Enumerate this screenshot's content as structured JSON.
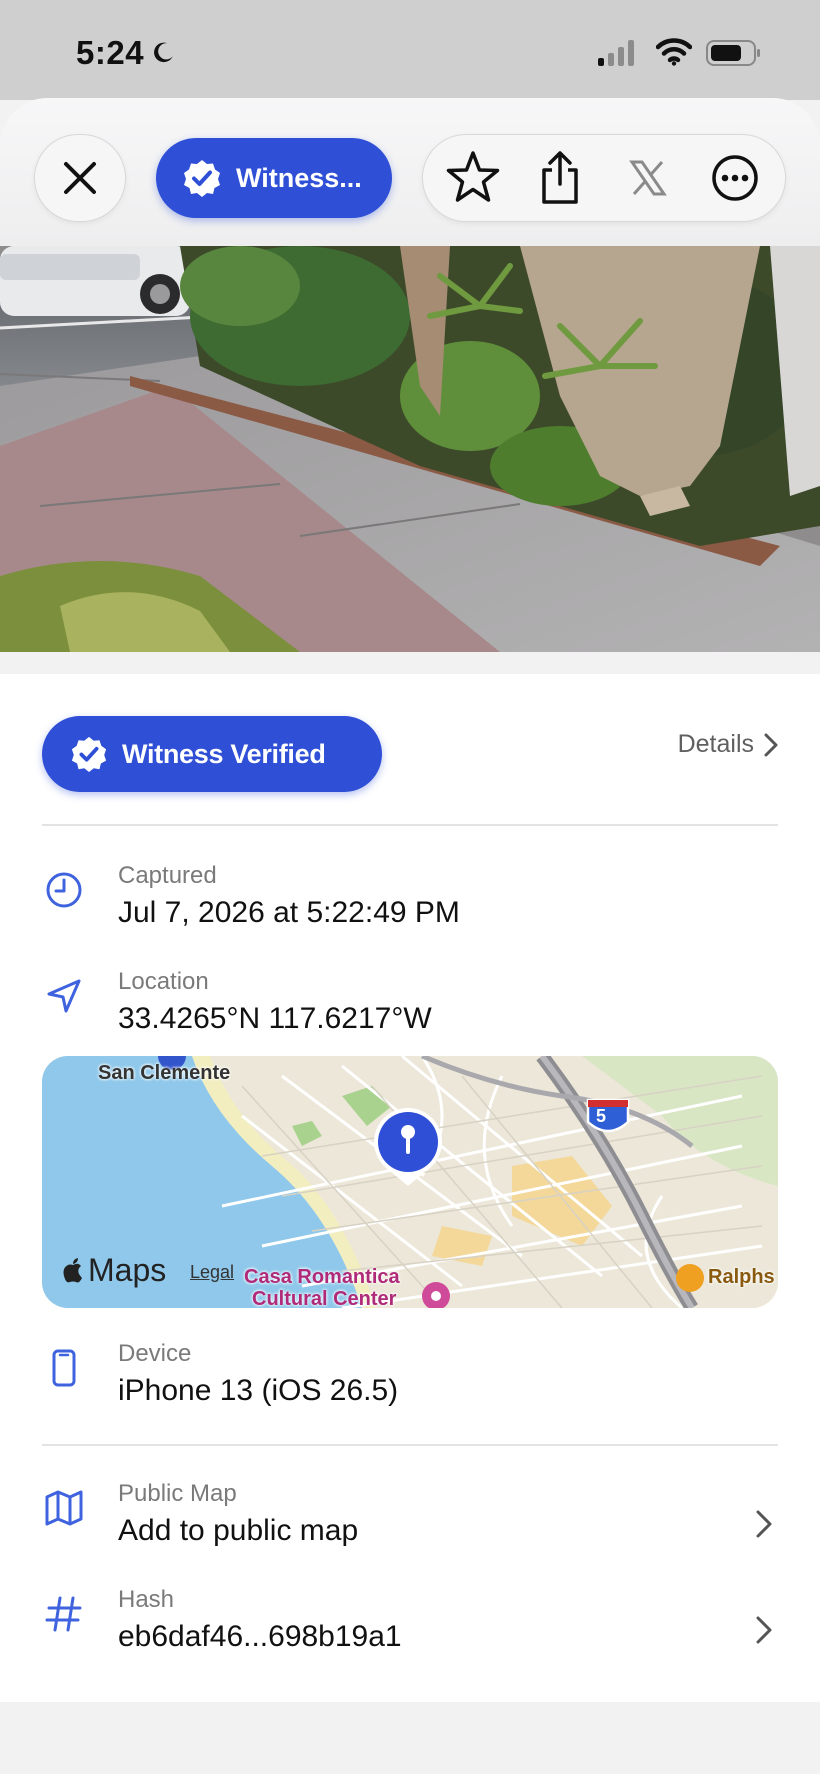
{
  "status_bar": {
    "time": "5:24"
  },
  "toolbar": {
    "witness_label": "Witness..."
  },
  "badge": {
    "label": "Witness Verified"
  },
  "details_link": "Details",
  "captured": {
    "label": "Captured",
    "value": "Jul 7, 2026 at 5:22:49 PM"
  },
  "location": {
    "label": "Location",
    "value": "33.4265°N 117.6217°W"
  },
  "map": {
    "labels": {
      "city": "San Clemente",
      "poi_line1": "Casa Romantica",
      "poi_line2": "Cultural Center",
      "store": "Ralphs",
      "highway": "5"
    },
    "brand": "Maps",
    "legal": "Legal"
  },
  "device": {
    "label": "Device",
    "value": "iPhone 13 (iOS 26.5)"
  },
  "public_map": {
    "label": "Public Map",
    "value": "Add to public map"
  },
  "hash": {
    "label": "Hash",
    "value": "eb6daf46...698b19a1"
  },
  "colors": {
    "accent": "#2e4fd6",
    "icon_blue": "#3f63de"
  },
  "icons": [
    "moon-icon",
    "cellular-signal-icon",
    "wifi-icon",
    "battery-icon",
    "close-icon",
    "verified-check-icon",
    "star-icon",
    "share-icon",
    "x-logo-icon",
    "more-icon",
    "chevron-right-icon",
    "clock-icon",
    "location-arrow-icon",
    "map-pin-icon",
    "phone-icon",
    "map-icon",
    "hash-icon"
  ]
}
